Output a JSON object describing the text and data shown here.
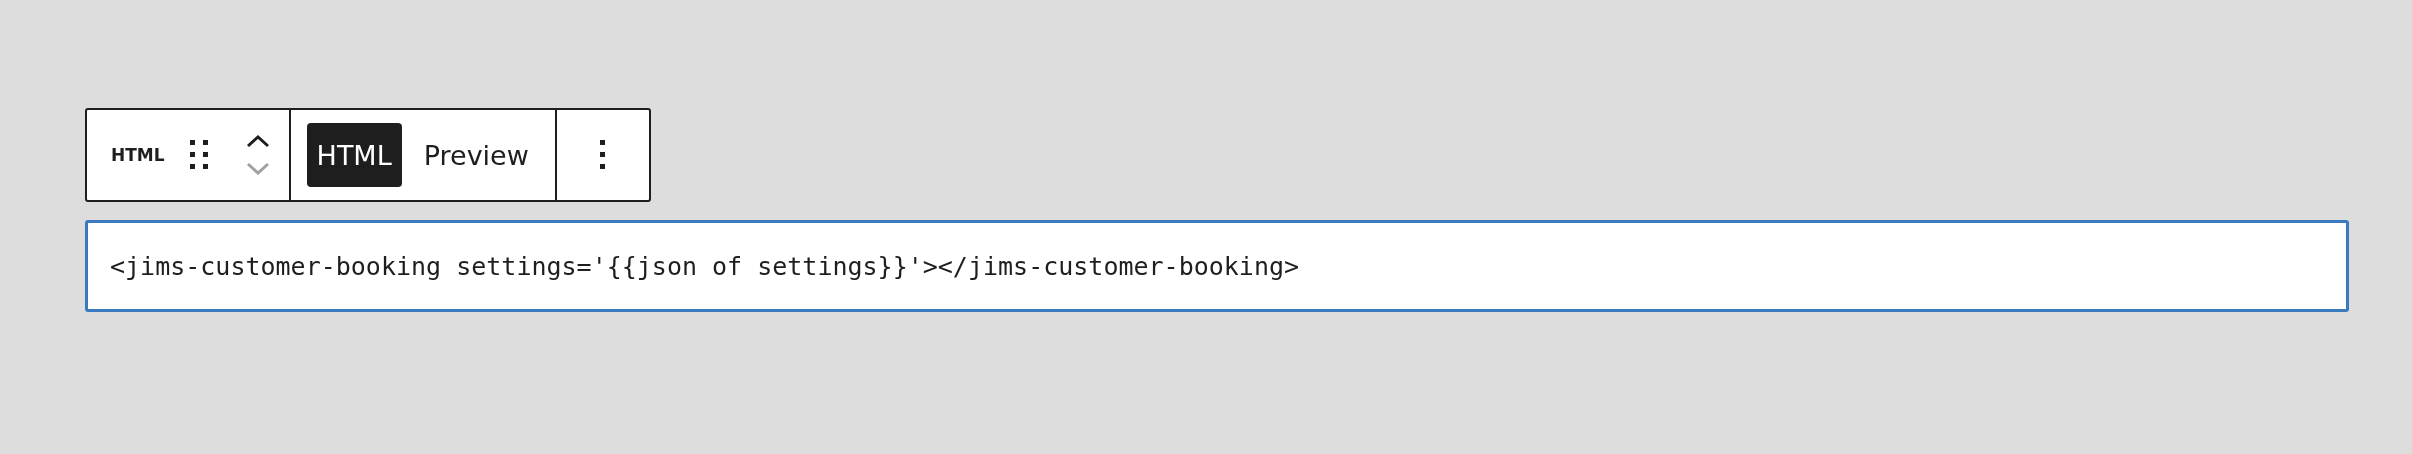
{
  "block_toolbar": {
    "block_label": "HTML",
    "move_up": {
      "disabled": false
    },
    "move_down": {
      "disabled": true
    },
    "modes": [
      {
        "label": "HTML",
        "selected": true
      },
      {
        "label": "Preview",
        "selected": false
      }
    ]
  },
  "code_editor": {
    "value": "<jims-customer-booking settings='{{json of settings}}'></jims-customer-booking>"
  }
}
